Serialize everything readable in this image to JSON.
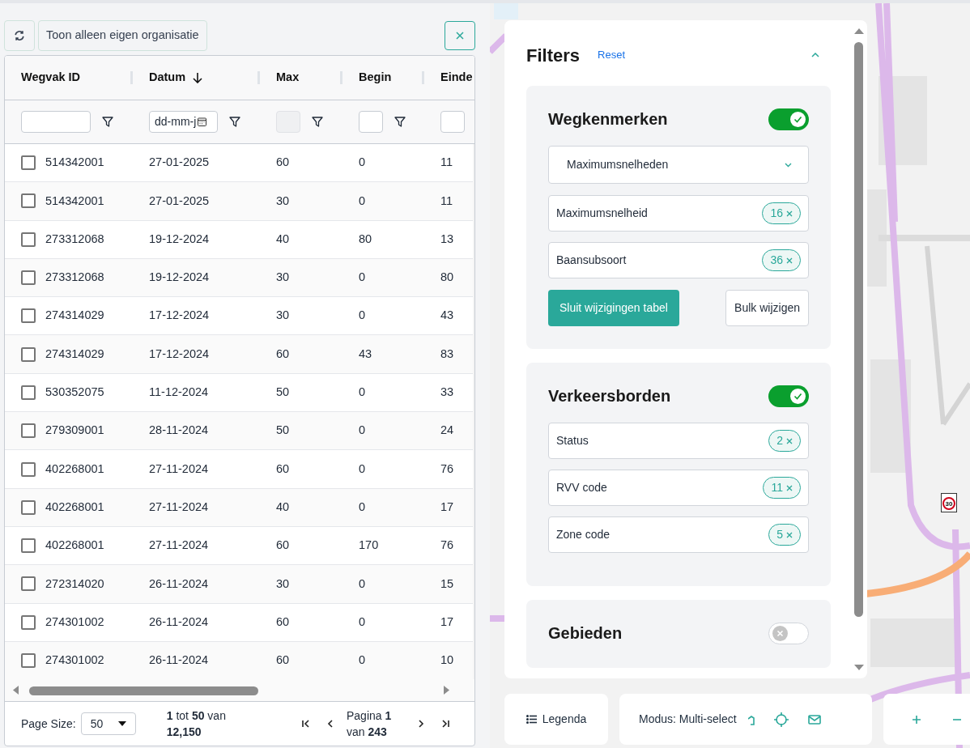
{
  "toolbar": {
    "only_own_org": "Toon alleen eigen organisatie"
  },
  "table": {
    "columns": [
      {
        "label": "Wegvak ID",
        "sorted": false,
        "filter": {
          "kind": "text"
        }
      },
      {
        "label": "Datum",
        "sorted": true,
        "filter": {
          "kind": "date",
          "placeholder": "dd-mm-j"
        }
      },
      {
        "label": "Max",
        "sorted": false,
        "filter": {
          "kind": "disabled"
        }
      },
      {
        "label": "Begin",
        "sorted": false,
        "filter": {
          "kind": "number"
        }
      },
      {
        "label": "Einde",
        "sorted": false,
        "filter": {
          "kind": "number"
        }
      }
    ],
    "rows": [
      {
        "selected": false,
        "cells": [
          "514342001",
          "27-01-2025",
          "60",
          "0",
          "11"
        ]
      },
      {
        "selected": false,
        "cells": [
          "514342001",
          "27-01-2025",
          "30",
          "0",
          "11"
        ]
      },
      {
        "selected": false,
        "cells": [
          "273312068",
          "19-12-2024",
          "40",
          "80",
          "13"
        ]
      },
      {
        "selected": false,
        "cells": [
          "273312068",
          "19-12-2024",
          "30",
          "0",
          "80"
        ]
      },
      {
        "selected": false,
        "cells": [
          "274314029",
          "17-12-2024",
          "30",
          "0",
          "43"
        ]
      },
      {
        "selected": false,
        "cells": [
          "274314029",
          "17-12-2024",
          "60",
          "43",
          "83"
        ]
      },
      {
        "selected": false,
        "cells": [
          "530352075",
          "11-12-2024",
          "50",
          "0",
          "33"
        ]
      },
      {
        "selected": false,
        "cells": [
          "279309001",
          "28-11-2024",
          "50",
          "0",
          "24"
        ]
      },
      {
        "selected": false,
        "cells": [
          "402268001",
          "27-11-2024",
          "60",
          "0",
          "76"
        ]
      },
      {
        "selected": false,
        "cells": [
          "402268001",
          "27-11-2024",
          "40",
          "0",
          "17"
        ]
      },
      {
        "selected": false,
        "cells": [
          "402268001",
          "27-11-2024",
          "60",
          "170",
          "76"
        ]
      },
      {
        "selected": false,
        "cells": [
          "272314020",
          "26-11-2024",
          "30",
          "0",
          "15"
        ]
      },
      {
        "selected": false,
        "cells": [
          "274301002",
          "26-11-2024",
          "60",
          "0",
          "17"
        ]
      },
      {
        "selected": false,
        "cells": [
          "274301002",
          "26-11-2024",
          "60",
          "0",
          "10"
        ]
      }
    ]
  },
  "pagination": {
    "page_size_label": "Page Size:",
    "page_size": "50",
    "summary": "**1** tot **50** van **12,150**",
    "page": "Pagina **1** van **243**"
  },
  "filters": {
    "title": "Filters",
    "reset": "Reset",
    "expanded": true,
    "sections": [
      {
        "title": "Wegkenmerken",
        "on": true,
        "dropdown": "Maximumsnelheden",
        "fields": [
          {
            "label": "Maximumsnelheid",
            "count": "16"
          },
          {
            "label": "Baansubsoort",
            "count": "36"
          }
        ],
        "buttons": [
          {
            "label": "Sluit wijzigingen tabel",
            "kind": "primary"
          },
          {
            "label": "Bulk wijzigen",
            "kind": "secondary"
          }
        ]
      },
      {
        "title": "Verkeersborden",
        "on": true,
        "fields": [
          {
            "label": "Status",
            "count": "2"
          },
          {
            "label": "RVV code",
            "count": "11"
          },
          {
            "label": "Zone code",
            "count": "5"
          }
        ]
      },
      {
        "title": "Gebieden",
        "on": false
      }
    ]
  },
  "map": {
    "sign": "30"
  },
  "map_bar": {
    "legend": "Legenda",
    "mode": "Modus: Multi-select"
  }
}
